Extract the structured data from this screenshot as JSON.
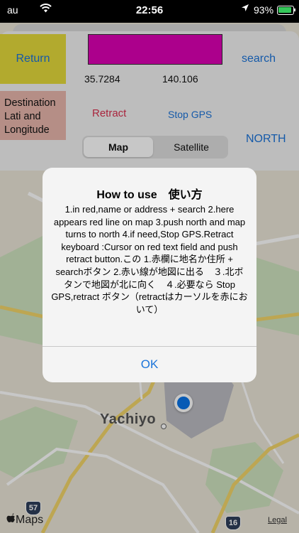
{
  "status_bar": {
    "carrier": "au",
    "wifi_icon": "wifi-icon",
    "time": "22:56",
    "location_icon": "location-arrow-icon",
    "battery_percent": "93%",
    "battery_level": 0.93,
    "battery_icon": "battery-charging-icon"
  },
  "controls": {
    "return_label": "Return",
    "name_input_value": "",
    "latitude": "35.7284",
    "longitude": "140.106",
    "search_label": "search",
    "destination_label": "Destination Lati and Longitude",
    "retract_label": "Retract",
    "stop_gps_label": "Stop GPS",
    "north_label": "NORTH",
    "map_type": {
      "options": [
        "Map",
        "Satellite"
      ],
      "selected": "Map"
    }
  },
  "alert": {
    "title": "How to use　使い方",
    "message": "1.in red,name or address + search 2.here appears red line on map 3.push north and map turns to  north 4.if need,Stop GPS.Retract keyboard :Cursor on red text field and push retract  button.この 1.赤欄に地名か住所 + searchボタン  2.赤い線が地図に出る　３.北ボタンで地図が北に向く　４.必要なら Stop GPS,retract ボタン（retractはカーソルを赤において）",
    "ok_label": "OK"
  },
  "map": {
    "place_label": "Yachiyo",
    "route_57": "57",
    "route_16": "16",
    "maps_brand": "Maps",
    "legal_label": "Legal"
  },
  "colors": {
    "return_bg": "#e5da3b",
    "name_input_bg": "#dd00b4",
    "destination_bg": "#e8b7ac",
    "retract_text": "#d9304f",
    "link_blue": "#1a73d9",
    "user_location": "#0a74e8"
  }
}
